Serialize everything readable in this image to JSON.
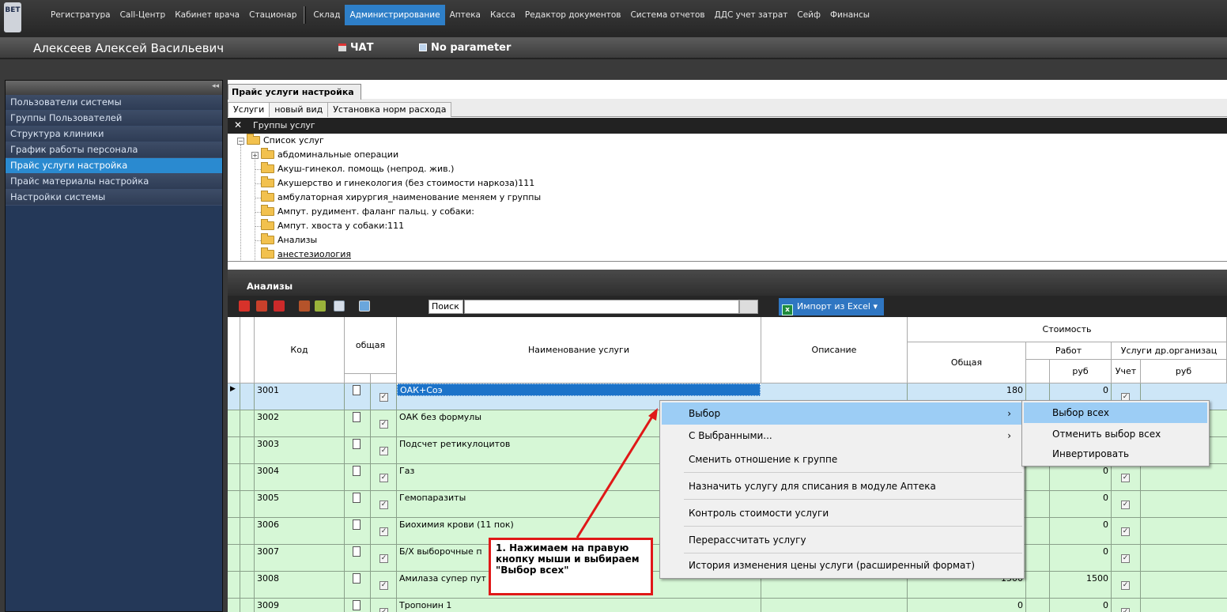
{
  "logo_text": "BET",
  "menu": [
    "Регистратура",
    "Call-Центр",
    "Кабинет врача",
    "Стационар",
    "Склад",
    "Администрирование",
    "Аптека",
    "Касса",
    "Редактор документов",
    "Система отчетов",
    "ДДС учет затрат",
    "Сейф",
    "Финансы"
  ],
  "menu_active": "Администрирование",
  "user": {
    "name": "Алексеев Алексей Васильевич",
    "chat": "ЧАТ",
    "param": "No parameter"
  },
  "sidebar": {
    "collapse": "◂◂",
    "items": [
      "Пользователи системы",
      "Группы Пользователей",
      "Структура клиники",
      "График работы персонала",
      "Прайс услуги настройка",
      "Прайс материалы настройка",
      "Настройки системы"
    ],
    "active": "Прайс услуги настройка"
  },
  "main_tab": "Прайс услуги настройка",
  "sub_tabs": [
    "Услуги",
    "новый вид",
    "Установка норм расхода"
  ],
  "group_bar": {
    "close": "✕",
    "title": "Группы услуг"
  },
  "tree": {
    "root": "Список услуг",
    "items": [
      "абдоминальные операции",
      "Акуш-гинекол. помощь (непрод. жив.)",
      "Акушерство и гинекология (без стоимости наркоза)111",
      "амбулаторная хирургия_наименование меняем у группы",
      "Ампут. рудимент. фаланг пальц. у собаки:",
      "Ампут. хвоста у собаки:111",
      "Анализы",
      "анестезиология"
    ]
  },
  "section_title": "Анализы",
  "search": {
    "label": "Поиск",
    "value": ""
  },
  "import_label": "Импорт из Excel",
  "grid": {
    "headers": {
      "code": "Код",
      "general": "общая",
      "name": "Наименование услуги",
      "desc": "Описание",
      "cost": "Стоимость",
      "total": "Общая",
      "work": "Работ",
      "other": "Услуги др.организац",
      "rub": "руб",
      "account": "Учет"
    },
    "rows": [
      {
        "code": "3001",
        "name": "ОАК+Соэ",
        "total": "180",
        "work": "0"
      },
      {
        "code": "3002",
        "name": "ОАК без формулы",
        "total": "",
        "work": ""
      },
      {
        "code": "3003",
        "name": "Подсчет ретикулоцитов",
        "total": "",
        "work": ""
      },
      {
        "code": "3004",
        "name": "Газ",
        "total": "",
        "work": "0"
      },
      {
        "code": "3005",
        "name": "Гемопаразиты",
        "total": "",
        "work": "0"
      },
      {
        "code": "3006",
        "name": "Биохимия крови (11 пок)",
        "total": "",
        "work": "0"
      },
      {
        "code": "3007",
        "name": "Б/Х выборочные п",
        "total": "",
        "work": "0"
      },
      {
        "code": "3008",
        "name": "Амилаза супер пут",
        "total": "1500",
        "work": "1500"
      },
      {
        "code": "3009",
        "name": "Тропонин 1",
        "total": "0",
        "work": "0"
      }
    ]
  },
  "context_menu": [
    "Выбор",
    "С Выбранными...",
    "Сменить отношение к группе",
    "Назначить услугу для списания в модуле Аптека",
    "Контроль стоимости услуги",
    "Перерассчитать услугу",
    "История изменения цены услуги (расширенный формат)"
  ],
  "submenu": [
    "Выбор всех",
    "Отменить выбор всех",
    "Инвертировать"
  ],
  "annotation": "1. Нажимаем на правую кнопку мыши и выбираем \"Выбор всех\""
}
